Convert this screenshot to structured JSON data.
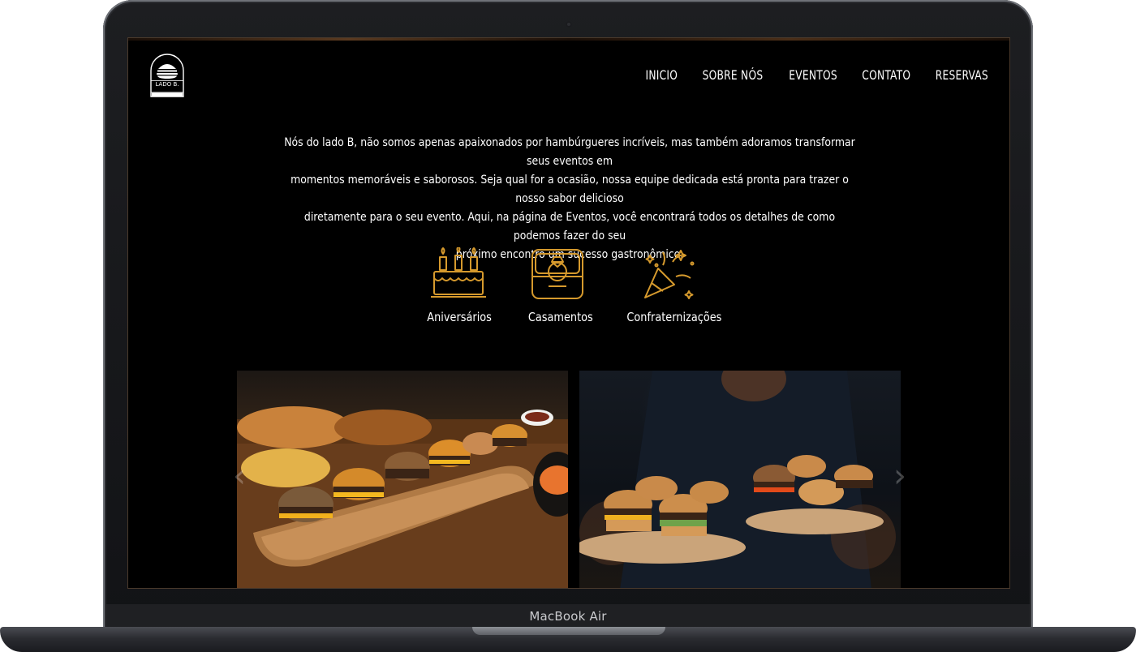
{
  "device": {
    "model_label": "MacBook Air"
  },
  "header": {
    "logo": {
      "brand": "LADO B.",
      "tagline": "BURGUER",
      "est": "EST 2023"
    },
    "nav": [
      {
        "label": "INICIO"
      },
      {
        "label": "SOBRE NÓS"
      },
      {
        "label": "EVENTOS"
      },
      {
        "label": "CONTATO"
      },
      {
        "label": "RESERVAS"
      }
    ]
  },
  "intro": {
    "lines": [
      "Nós do lado B, não somos apenas apaixonados por hambúrgueres incríveis, mas também adoramos transformar seus eventos em",
      "momentos memoráveis e saborosos. Seja qual for a ocasião, nossa equipe dedicada está pronta para trazer o nosso sabor delicioso",
      "diretamente para o seu evento. Aqui, na página de Eventos, você encontrará todos os detalhes de como podemos fazer do seu",
      "próximo encontro um sucesso gastronômico."
    ]
  },
  "events": [
    {
      "label": "Aniversários",
      "icon": "birthday-cake-icon"
    },
    {
      "label": "Casamentos",
      "icon": "wedding-ring-box-icon"
    },
    {
      "label": "Confraternizações",
      "icon": "party-popper-icon"
    }
  ],
  "gallery": {
    "photos": [
      {
        "subject": "burger-sliders-board-photo"
      },
      {
        "subject": "server-holding-burger-trays-photo"
      }
    ]
  },
  "colors": {
    "background": "#000000",
    "accent_gold": "#d69a2d",
    "text": "#ffffff"
  }
}
